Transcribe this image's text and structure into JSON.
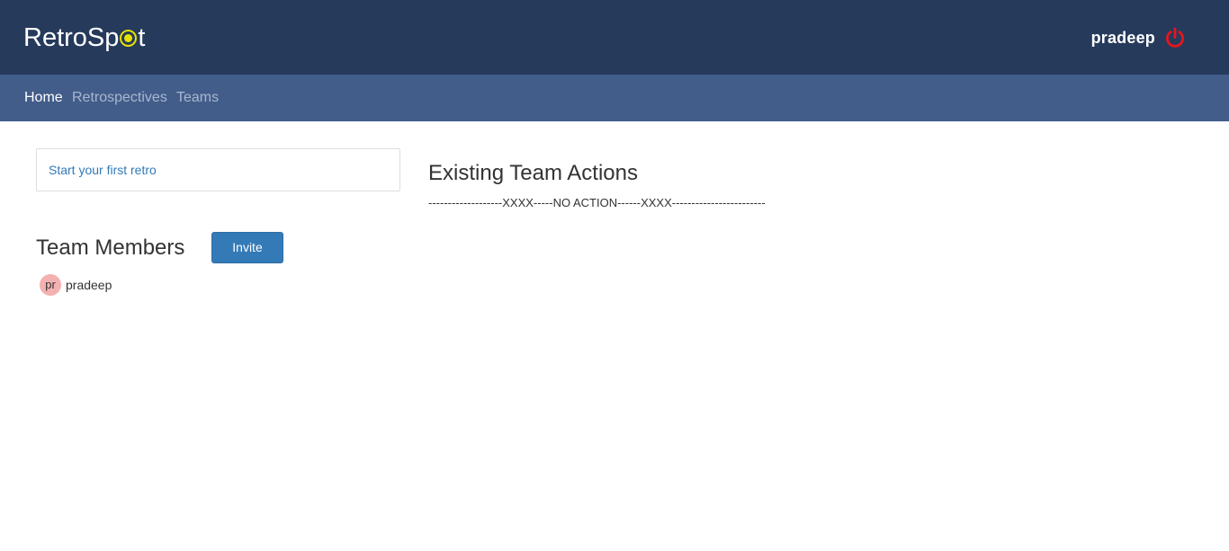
{
  "app": {
    "logo_prefix": "RetroSp",
    "logo_suffix": "t"
  },
  "header": {
    "username": "pradeep",
    "power_icon": "power-icon",
    "power_icon_color": "#e8141c"
  },
  "nav": {
    "items": [
      {
        "label": "Home",
        "active": true
      },
      {
        "label": "Retrospectives",
        "active": false
      },
      {
        "label": "Teams",
        "active": false
      }
    ]
  },
  "main": {
    "start_retro_link": "Start your first retro",
    "team_members_title": "Team Members",
    "invite_label": "Invite",
    "members": [
      {
        "initials": "pr",
        "name": "pradeep"
      }
    ],
    "existing_actions_title": "Existing Team Actions",
    "existing_actions_text": "-------------------XXXX-----NO ACTION------XXXX------------------------"
  },
  "colors": {
    "topbar": "#263a5c",
    "navbar": "#425d8a",
    "accent": "#337ab7",
    "logo_accent": "#e8e300",
    "avatar_bg": "#f4b1b1"
  }
}
